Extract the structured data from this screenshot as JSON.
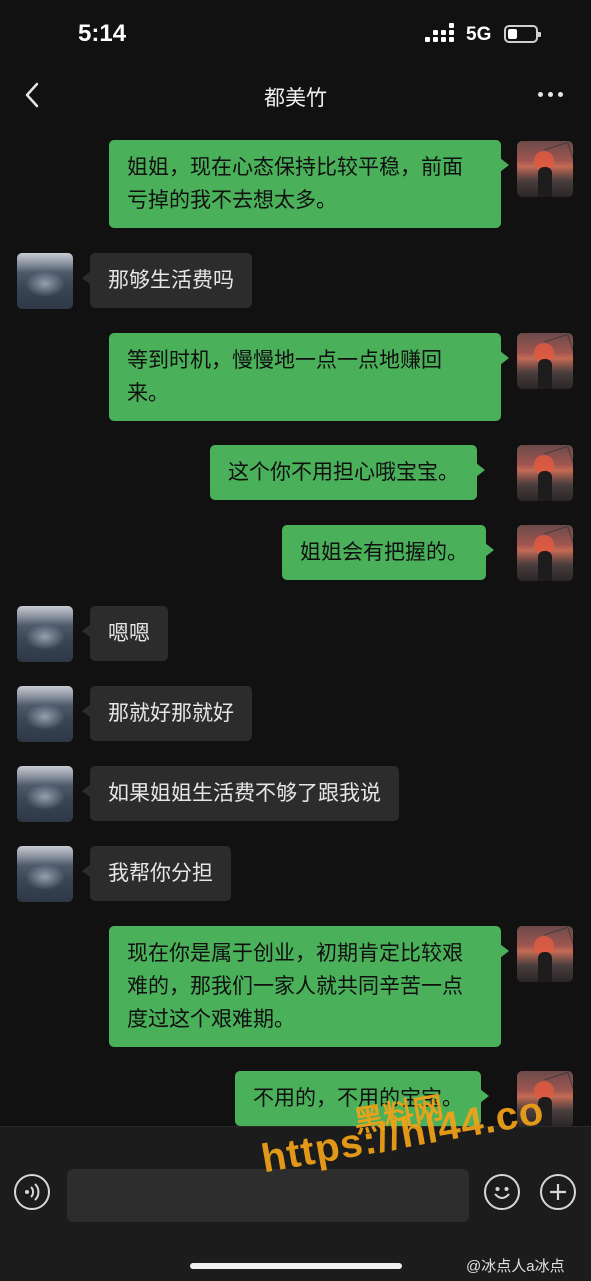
{
  "status_bar": {
    "time": "5:14",
    "network": "5G"
  },
  "nav": {
    "title": "都美竹",
    "back_icon": "chevron-left-icon",
    "more_icon": "more-dots-icon"
  },
  "messages": [
    {
      "from": "me",
      "text": "姐姐，现在心态保持比较平稳，前面亏掉的我不去想太多。"
    },
    {
      "from": "friend",
      "text": "那够生活费吗"
    },
    {
      "from": "me",
      "text": "等到时机，慢慢地一点一点地赚回来。"
    },
    {
      "from": "me",
      "text": "这个你不用担心哦宝宝。"
    },
    {
      "from": "me",
      "text": "姐姐会有把握的。"
    },
    {
      "from": "friend",
      "text": "嗯嗯"
    },
    {
      "from": "friend",
      "text": "那就好那就好"
    },
    {
      "from": "friend",
      "text": "如果姐姐生活费不够了跟我说"
    },
    {
      "from": "friend",
      "text": "我帮你分担"
    },
    {
      "from": "me",
      "text": "现在你是属于创业，初期肯定比较艰难的，那我们一家人就共同辛苦一点度过这个艰难期。"
    },
    {
      "from": "me",
      "text": "不用的，不用的宝宝。"
    }
  ],
  "input_bar": {
    "voice_icon": "voice-icon",
    "emoji_icon": "emoji-icon",
    "plus_icon": "plus-icon",
    "input_value": ""
  },
  "watermark": {
    "line1": "黑料网",
    "line2": "https://hl44.co"
  },
  "credit": "@冰点人a冰点",
  "colors": {
    "background": "#111111",
    "sent_bubble": "#4ab05a",
    "received_bubble": "#2c2c2c",
    "watermark": "#f2a218"
  }
}
